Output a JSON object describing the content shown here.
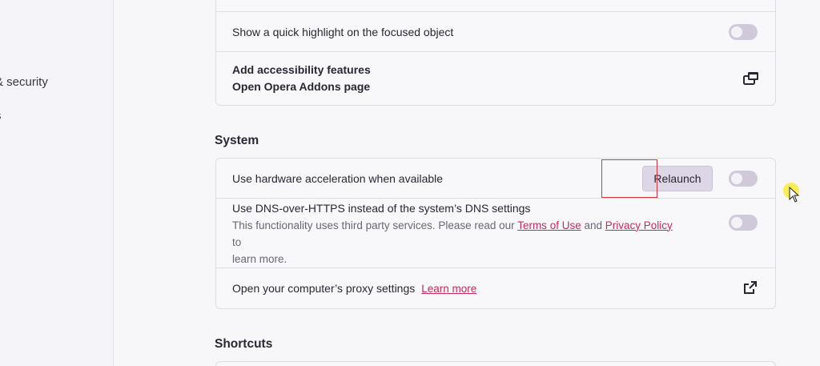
{
  "sidebar": {
    "items": [
      {
        "label": "& security"
      },
      {
        "label": "s"
      },
      {
        "label": "."
      }
    ]
  },
  "accessibility": {
    "highlight_label": "Show a quick highlight on the focused object",
    "highlight_toggle": "off",
    "addons_title": "Add accessibility features",
    "addons_subtitle": "Open Opera Addons page"
  },
  "system": {
    "title": "System",
    "hw_accel_label": "Use hardware acceleration when available",
    "relaunch_label": "Relaunch",
    "hw_accel_toggle": "off",
    "dns_label": "Use DNS-over-HTTPS instead of the system’s DNS settings",
    "dns_desc_before": "This functionality uses third party services. Please read our",
    "dns_terms_link": "Terms of Use",
    "dns_and": "and",
    "dns_privacy_link": "Privacy Policy",
    "dns_to": "to",
    "dns_desc_after": "learn more.",
    "dns_toggle": "off",
    "proxy_label": "Open your computer’s proxy settings",
    "proxy_learn_more": "Learn more"
  },
  "shortcuts": {
    "title": "Shortcuts"
  },
  "colors": {
    "accent_link": "#c8295a",
    "toggle_off": "#cfc9da",
    "highlight_box": "#d9343e"
  }
}
